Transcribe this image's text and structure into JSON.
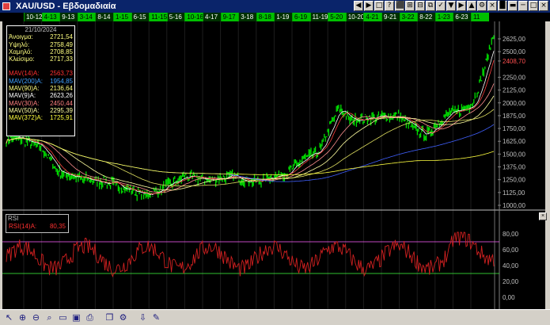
{
  "window": {
    "title": "XAU/USD - Εβδομαδιαία"
  },
  "title_buttons": [
    "◀",
    "▶",
    "□",
    "?",
    "⬛",
    "⊞",
    "⊟",
    "⧉",
    "✓",
    "▼",
    "▶",
    "▲",
    "⚙",
    "×",
    "█",
    "▬",
    "─",
    "□",
    "×"
  ],
  "ruler": [
    "10-12",
    "4-13",
    "9-13",
    "3-14",
    "8-14",
    "1-15",
    "6-15",
    "11-15",
    "5-16",
    "10-16",
    "4-17",
    "9-17",
    "3-18",
    "8-18",
    "1-19",
    "6-19",
    "11-19",
    "5-20",
    "10-20",
    "4-21",
    "9-21",
    "3-22",
    "8-22",
    "1-23",
    "6-23",
    "11"
  ],
  "info": {
    "date": "21/10/2024",
    "ohlc": [
      {
        "label": "Άνοιγμα:",
        "value": "2721,54",
        "color": "#ffff80"
      },
      {
        "label": "Υψηλό:",
        "value": "2758,49",
        "color": "#ffff80"
      },
      {
        "label": "Χαμηλό:",
        "value": "2708,85",
        "color": "#ffff80"
      },
      {
        "label": "Κλείσιμο:",
        "value": "2717,33",
        "color": "#ffff80"
      }
    ],
    "mavs": [
      {
        "label": "MAV(14)A:",
        "value": "2563,73",
        "color": "#ff3030"
      },
      {
        "label": "MAV(200)A:",
        "value": "1954,85",
        "color": "#40a0ff"
      },
      {
        "label": "",
        "value": "",
        "color": "#000"
      },
      {
        "label": "MAV(90)A:",
        "value": "2136,64",
        "color": "#ffff80"
      },
      {
        "label": "MAV(9)A:",
        "value": "2623,26",
        "color": "#ffffff"
      },
      {
        "label": "MAV(30)A:",
        "value": "2450,44",
        "color": "#ff8080"
      },
      {
        "label": "MAV(50)A:",
        "value": "2295,39",
        "color": "#ffffa0"
      },
      {
        "label": "MAV(372)A:",
        "value": "1725,91",
        "color": "#ffff40"
      }
    ]
  },
  "price_axis": [
    "2625,00",
    "2500,00",
    "2408,70",
    "2250,00",
    "2125,00",
    "2000,00",
    "1875,00",
    "1750,00",
    "1625,00",
    "1500,00",
    "1375,00",
    "1250,00",
    "1125,00",
    "1000,00"
  ],
  "rsi": {
    "title": "RSI",
    "label": "RSI(14)A:",
    "value": "80,35",
    "axis": [
      "80,00",
      "60,00",
      "40,00",
      "20,00",
      "0,00"
    ]
  },
  "toolbar": [
    "cursor",
    "zoom-in",
    "zoom-out",
    "search",
    "open",
    "save",
    "print",
    "sep",
    "copy",
    "settings",
    "sep",
    "export",
    "draw"
  ],
  "colors": {
    "price": "#00ff00",
    "rsi": "#e02020",
    "grid": "#303030"
  }
}
